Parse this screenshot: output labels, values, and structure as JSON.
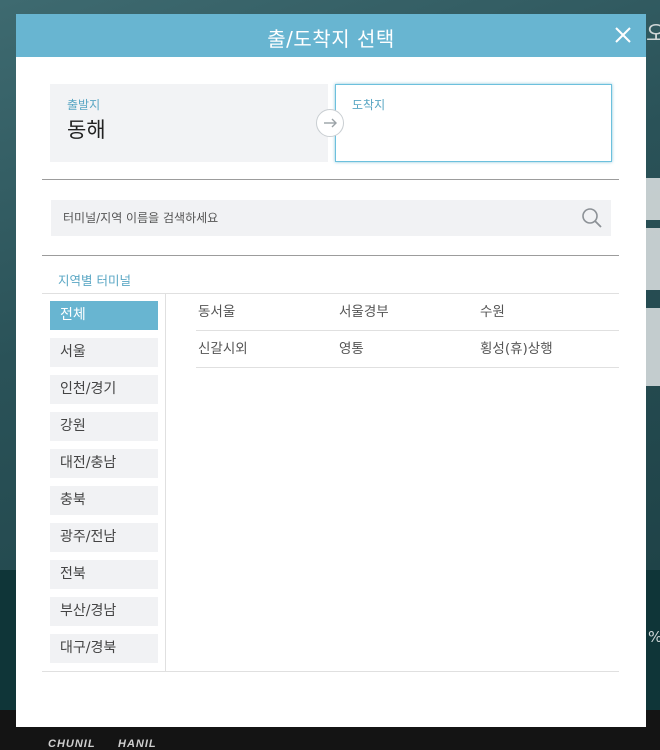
{
  "modal": {
    "title": "출/도착지 선택",
    "departure": {
      "label": "출발지",
      "value": "동해"
    },
    "arrival": {
      "label": "도착지",
      "value": ""
    },
    "search": {
      "placeholder": "터미널/지역 이름을 검색하세요"
    },
    "section_title": "지역별 터미널",
    "regions": [
      "전체",
      "서울",
      "인천/경기",
      "강원",
      "대전/충남",
      "충북",
      "광주/전남",
      "전북",
      "부산/경남",
      "대구/경북"
    ],
    "selected_region": "전체",
    "terminals": [
      [
        "동서울",
        "서울경부",
        "수원"
      ],
      [
        "신갈시외",
        "영통",
        "횡성(휴)상행"
      ]
    ]
  },
  "background": {
    "right_edge_text": "오",
    "right_edge_symbol": "%",
    "footer_logos": [
      "CHUNIL",
      "HANIL"
    ]
  },
  "colors": {
    "accent": "#68b5d1",
    "header_bg": "#68b5d1",
    "panel_bg": "#f1f2f4"
  }
}
